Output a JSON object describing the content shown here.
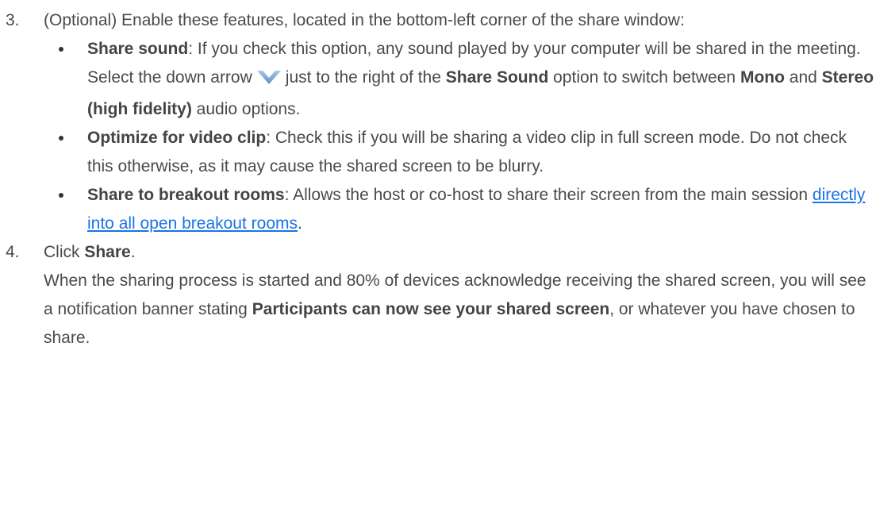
{
  "steps": [
    {
      "number": "3.",
      "intro": "(Optional) Enable these features, located in the bottom-left corner of the share window:",
      "bullets": [
        {
          "term": "Share sound",
          "sep": ": ",
          "text1": "If you check this option, any sound played by your computer will be shared in the meeting. Select the down arrow",
          "icon": "chevron-down-icon",
          "text2": "just to the right of the",
          "term2": "Share Sound",
          "text3": "option to switch between",
          "term3": "Mono",
          "text4": "and",
          "term4": "Stereo (high fidelity)",
          "text5": "audio options."
        },
        {
          "term": "Optimize for video clip",
          "sep": ": ",
          "text1": "Check this if you will be sharing a video clip in full screen mode. Do not check this otherwise, as it may cause the shared screen to be blurry."
        },
        {
          "term": "Share to breakout rooms",
          "sep": ": ",
          "text1": "Allows the host or co-host to share their screen from the main session",
          "link": "directly into all open breakout rooms",
          "end": "."
        }
      ]
    },
    {
      "number": "4.",
      "pre": "Click",
      "action": "Share",
      "post": ".",
      "note_pre": "When the sharing process is started and 80% of devices acknowledge receiving the shared screen, you will see a notification banner stating",
      "note_term": "Participants can now see your shared screen",
      "note_post": ", or whatever you have chosen to share."
    }
  ],
  "colors": {
    "text": "#4a4a4a",
    "link": "#1a73e8",
    "chevron": "#7aa7d6"
  }
}
